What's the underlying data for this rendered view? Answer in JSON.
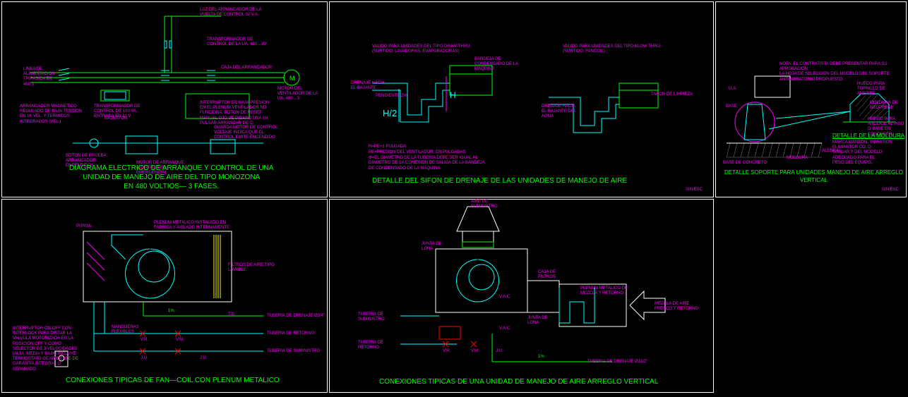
{
  "panel1": {
    "title": "DIAGRAMA ELECTRICO DE ARRANQUE Y CONTROL DE UNA\nUNIDAD DE MANEJO DE AIRE DEL TIPO MONOZONA\nEN 480 VOLTIOS— 3 FASES.",
    "annots": {
      "a1": "LINEA DE ALIMENTACION TRIFASICA EN 480 V",
      "a2": "ARRANCADOR MAGNETICO REGULADO DE BAJA TENSION EN 1K VEL. Y TERMICOS INTEGRADOS (VEL.)",
      "a3": "TRANSFORMADOR DE CONTROL DE 100 VA ENTRADA EN 32 V",
      "a4": "LUZ DEL ARRANCADOR DE LA VUELTA DE CONTROL 32 V.A.",
      "a5": "TRANSFORMADOR DE CONTROL DE LA UA, 480→3V",
      "a6": "MOTOR DEL VENTILADOR DE LA UA, 480→3",
      "a7": "CAJA DEL ARRANCADOR",
      "a8": "BOTON DE PRUEBA ARRANCADOR ENCENDIDO)",
      "a9": "GUARDA MOTOR DE CONTROL VOLTAJE INDICA QUE EL CONTROL EMITE ENCENDIDO",
      "a10": "MOTOR DE ARRANQUE (CONTACTOR EMERGENCIA)",
      "a11": "INTERRUPTOR DE BAJA PRESION EN EL PLENUM VENTILADOR NO FUNCIONA. BOTON DE RESET MANUAL OJO SE DIBARO UNA UA PULSAR ARRANCAR DE C."
    },
    "labels": {
      "m1": "UA1620 ON",
      "m2": "M"
    }
  },
  "panel2": {
    "title": "DETALLE DEL SIFON DE DRENAJE DE LAS UNIDADES DE MANEJO DE AIRE",
    "note": "H=PE+1 PULGADA\nPE=PRESION DEL VENTILADOR, EN PULGADAS\nΦ=EL DIAMETRO DE LA TUBERIA DEBE SER IGUAL AL\nDIAMETRO DE LA CONEXION DE SALIDA DE LA BANDEJA\nDE CONDENSADO DE LA MAQUINA.",
    "h": "H",
    "h2": "H/2",
    "annots": {
      "a1": "VALIDO PARA UNIDADES DEL TIPO DRAW-THRU (SURTIDO: LAVADORAS, EVAPORADORAS)",
      "a2": "VALIDO PARA UNIDADES DEL TIPO BLOW-THRU (SURTIDO: FANCOIL)",
      "a3": "BANDEJA DE CONDENSADO DE LA MAQUINA",
      "a4": "DRENAJE HACIA EL BAJANTE",
      "a5": "PENDIENTE 2%",
      "a6": "TAPON DE LIMPIEZA",
      "a7": "DRENAJE HACIA EL BAJANTE DEL AGUA"
    }
  },
  "panel3": {
    "title": "DETALLE SOPORTE PARA UNIDADES MANEJO DE AIRE ARREGLO VERTICAL",
    "note": "NOTA: EL CONTRATISTA DEBE PRESENTAR PARA SU APROBACION\nLA HOJA DE SELECCION DEL MODELO DEL SOPORTE\nANTIVIBRATORIO PROPUESTO.",
    "subtitle": "DETALLE DE LA MOLDURA",
    "subnote": "MARCA MANSON, VIBRATION ELIMINATOR CO. O\nSIMILAR Y DEL MODELO ADECUADO PARA EL\nPESO DEL EQUIPO.",
    "annots": {
      "a1": "U.A.",
      "a2": "BASE",
      "a3": "BASE DE CONCRETO",
      "a4": "MOLDURA",
      "a5": "ALDNKA",
      "a6": "HUECO PARA TORNILLO DE AMARRE",
      "a7": "MOLDURA DE NEOPRENE",
      "a8": "HUECO PARA ANCLAJE AL PISO O BASE EN CONCRETO"
    }
  },
  "panel4": {
    "title": "CONEXIONES TIPICAS DE FAN—COIL CON PLENUM METALICO",
    "annots": {
      "a1": "PURGA",
      "a2": "PLENUM METALICO INSTALADO EN FABRICA Y AISLADO INTERNAMENTE",
      "a3": "FILTROS DE AIRE TIPO LAVABLE",
      "a4": "TUBERIA DE DRENAJE Ø3/4\"",
      "a5": "TUBERIA DE RETORNO",
      "a6": "TUBERIA DE SUMINISTRO",
      "a7": "MANGUERAS FLEXIBLES",
      "a8": "INTERRUPTOR ON-OFF CON INTERLOCK PARA DISTAR LA VALVULA MOTORIZADA EN LA POSICION OFF Y COMO SELECTOR DE 3 VELOCIDADES (ALTA, MEDIA Y BAJA) INCLUYE TERMOSTATO DE AMBIENTE DE GARANTIA INTEGRAL O SEPARADO"
    },
    "labels": {
      "vr": "V.R.",
      "vm": "V.M.",
      "ts": "T.S.",
      "jl": "J.U.",
      "one": "1%"
    }
  },
  "panel5": {
    "title": "CONEXIONES TIPICAS DE UNA UNIDAD DE MANEJO DE AIRE ARREGLO VERTICAL",
    "annots": {
      "a1": "AIRE DE SUMINISTRO",
      "a2": "JUNTA DE LONA",
      "a3": "CAJA DE FILTROS",
      "a4": "JUNTA DE LONA",
      "a5": "PLENUM METALICO DE MEZCLA Y RETORNO",
      "a6": "MEZCLA DE AIRE FRESCO Y RETORNO",
      "a7": "TUBERIA DE SUMINISTRO",
      "a8": "TUBERIA DE RETORNO",
      "a9": "TUBERIA DE DRENAJE Ø11/2\"",
      "a10": "V.A.C.",
      "a11": "V.A.C."
    },
    "labels": {
      "vr": "V.R.",
      "vm": "V.M.",
      "jl": "J.U.",
      "one": "1%"
    }
  },
  "scale": "SIN/ESC"
}
